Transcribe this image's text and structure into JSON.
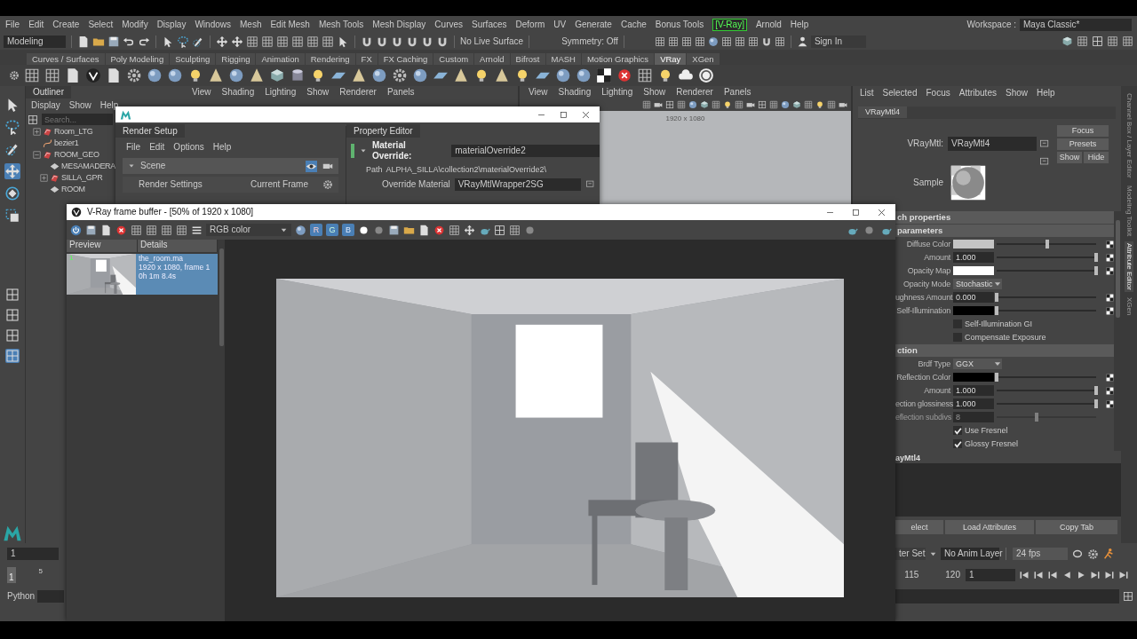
{
  "menu_bar": [
    {
      "label": "File",
      "highlighted": false
    },
    {
      "label": "Edit",
      "highlighted": false
    },
    {
      "label": "Create",
      "highlighted": false
    },
    {
      "label": "Select",
      "highlighted": false
    },
    {
      "label": "Modify",
      "highlighted": false
    },
    {
      "label": "Display",
      "highlighted": false
    },
    {
      "label": "Windows",
      "highlighted": false
    },
    {
      "label": "Mesh",
      "highlighted": false
    },
    {
      "label": "Edit Mesh",
      "highlighted": false
    },
    {
      "label": "Mesh Tools",
      "highlighted": false
    },
    {
      "label": "Mesh Display",
      "highlighted": false
    },
    {
      "label": "Curves",
      "highlighted": false
    },
    {
      "label": "Surfaces",
      "highlighted": false
    },
    {
      "label": "Deform",
      "highlighted": false
    },
    {
      "label": "UV",
      "highlighted": false
    },
    {
      "label": "Generate",
      "highlighted": false
    },
    {
      "label": "Cache",
      "highlighted": false
    },
    {
      "label": "Bonus Tools",
      "highlighted": false
    },
    {
      "label": "[V-Ray]",
      "highlighted": true
    },
    {
      "label": "Arnold",
      "highlighted": false
    },
    {
      "label": "Help",
      "highlighted": false
    }
  ],
  "workspace": {
    "label": "Workspace :",
    "value": "Maya Classic*"
  },
  "status_line": {
    "mode": "Modeling",
    "live_surface": "No Live Surface",
    "symmetry": "Symmetry: Off",
    "sign_in": "Sign In"
  },
  "shelf_tabs": [
    {
      "label": "Curves / Surfaces",
      "selected": false
    },
    {
      "label": "Poly Modeling",
      "selected": false
    },
    {
      "label": "Sculpting",
      "selected": false
    },
    {
      "label": "Rigging",
      "selected": false
    },
    {
      "label": "Animation",
      "selected": false
    },
    {
      "label": "Rendering",
      "selected": false
    },
    {
      "label": "FX",
      "selected": false
    },
    {
      "label": "FX Caching",
      "selected": false
    },
    {
      "label": "Custom",
      "selected": false
    },
    {
      "label": "Arnold",
      "selected": false
    },
    {
      "label": "Bifrost",
      "selected": false
    },
    {
      "label": "MASH",
      "selected": false
    },
    {
      "label": "Motion Graphics",
      "selected": false
    },
    {
      "label": "VRay",
      "selected": true
    },
    {
      "label": "XGen",
      "selected": false
    }
  ],
  "outliner": {
    "title": "Outliner",
    "menu": [
      "Display",
      "Show",
      "Help"
    ],
    "search_placeholder": "Search...",
    "items": [
      {
        "label": "Room_LTG",
        "kind": "group",
        "expanded": false
      },
      {
        "label": "bezier1",
        "kind": "curve"
      },
      {
        "label": "ROOM_GEO",
        "kind": "group",
        "expanded": true,
        "children": [
          {
            "label": "MESAMADERA",
            "kind": "mesh"
          },
          {
            "label": "SILLA_GPR",
            "kind": "group",
            "expanded": false
          },
          {
            "label": "ROOM",
            "kind": "mesh"
          }
        ]
      }
    ]
  },
  "viewports": [
    {
      "menu": [
        "View",
        "Shading",
        "Lighting",
        "Show",
        "Renderer",
        "Panels"
      ]
    },
    {
      "menu": [
        "View",
        "Shading",
        "Lighting",
        "Show",
        "Renderer",
        "Panels"
      ],
      "resolution": "1920 x 1080"
    }
  ],
  "render_setup": {
    "tab": "Render Setup",
    "menu": [
      "File",
      "Edit",
      "Options",
      "Help"
    ],
    "scene": {
      "label": "Scene",
      "expanded": true
    },
    "rows": [
      {
        "label": "Render Settings",
        "value": "Current Frame"
      }
    ],
    "property_editor": {
      "tab": "Property Editor",
      "override_label": "Material Override:",
      "override_value": "materialOverride2",
      "path_label": "Path",
      "path": "ALPHA_SILLA\\collection2\\materialOverride2\\",
      "material_label": "Override Material",
      "material_value": "VRayMtlWrapper2SG"
    }
  },
  "frame_buffer": {
    "title": "V-Ray frame buffer - [50% of 1920 x 1080]",
    "channel": "RGB color",
    "channels": [
      {
        "label": "R",
        "selected": true
      },
      {
        "label": "G",
        "selected": true
      },
      {
        "label": "B",
        "selected": true
      }
    ],
    "history": {
      "columns": [
        "Preview",
        "Details"
      ],
      "items": [
        {
          "index": "1",
          "lines": [
            "the_room.ma",
            "1920 x 1080, frame 1",
            "0h 1m 8.4s"
          ],
          "selected": true
        }
      ]
    }
  },
  "attribute_editor": {
    "menu": [
      "List",
      "Selected",
      "Focus",
      "Attributes",
      "Show",
      "Help"
    ],
    "tab": "VRayMtl4",
    "node_label": "VRayMtl:",
    "node_value": "VRayMtl4",
    "buttons": [
      "Focus",
      "Presets",
      "Show",
      "Hide"
    ],
    "sample_label": "Sample",
    "sections": [
      {
        "title": "ch properties"
      },
      {
        "title": "parameters",
        "rows": [
          {
            "kind": "color",
            "label": "Diffuse Color",
            "color": "#c4c4c4",
            "level": 0.51
          },
          {
            "kind": "number",
            "label": "Amount",
            "value": "1.000",
            "level": 1,
            "disabled": false
          },
          {
            "kind": "color",
            "label": "Opacity Map",
            "color": "#ffffff",
            "level": 1
          },
          {
            "kind": "dropdown",
            "label": "Opacity Mode",
            "value": "Stochastic"
          },
          {
            "kind": "number",
            "label": "ughness Amount",
            "value": "0.000",
            "level": 0,
            "disabled": false
          },
          {
            "kind": "color",
            "label": "Self-Illumination",
            "color": "#000000",
            "level": 0
          },
          {
            "kind": "checkbox",
            "label": "Self-Illumination GI",
            "checked": false
          },
          {
            "kind": "checkbox",
            "label": "Compensate Exposure",
            "checked": false
          }
        ]
      },
      {
        "title": "ction",
        "rows": [
          {
            "kind": "dropdown",
            "label": "Brdf Type",
            "value": "GGX"
          },
          {
            "kind": "color",
            "label": "Reflection Color",
            "color": "#000000",
            "level": 0
          },
          {
            "kind": "number",
            "label": "Amount",
            "value": "1.000",
            "level": 1,
            "disabled": false
          },
          {
            "kind": "number",
            "label": "ection glossiness",
            "value": "1.000",
            "level": 1,
            "disabled": false
          },
          {
            "kind": "number",
            "label": "eflection subdivs",
            "value": "8",
            "level": 0.4,
            "disabled": true
          },
          {
            "kind": "checkbox",
            "label": "Use Fresnel",
            "checked": true
          },
          {
            "kind": "checkbox",
            "label": "Glossy Fresnel",
            "checked": true
          }
        ]
      }
    ],
    "notes_label": "ayMtl4",
    "bottom_buttons": [
      "elect",
      "Load Attributes",
      "Copy Tab"
    ]
  },
  "side_tabs": [
    {
      "label": "Channel Box / Layer Editor",
      "selected": false
    },
    {
      "label": "Modeling Toolkit",
      "selected": false
    },
    {
      "label": "Attribute Editor",
      "selected": true
    },
    {
      "label": "XGen",
      "selected": false
    }
  ],
  "range_slider": {
    "start": "1",
    "character_set": "ter Set",
    "anim_layer": "No Anim Layer",
    "fps": "24 fps"
  },
  "time_slider": {
    "current_marker": "1",
    "ticks_start": [
      "5"
    ],
    "ticks_end": [
      "115",
      "120"
    ],
    "current_frame": "1"
  },
  "command_line": {
    "language": "Python"
  }
}
